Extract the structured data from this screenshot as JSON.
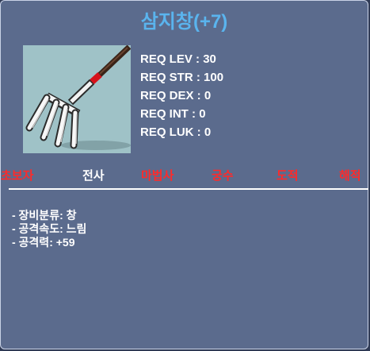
{
  "item": {
    "name": "삼지창(+7)",
    "name_color": "#5ab4ee",
    "icon": "trident-fork-icon"
  },
  "requirements": [
    {
      "label": "REQ LEV",
      "value": "30"
    },
    {
      "label": "REQ STR",
      "value": "100"
    },
    {
      "label": "REQ DEX",
      "value": "0"
    },
    {
      "label": "REQ INT",
      "value": "0"
    },
    {
      "label": "REQ LUK",
      "value": "0"
    }
  ],
  "jobs": [
    {
      "name": "초보자",
      "available": false
    },
    {
      "name": "전사",
      "available": true
    },
    {
      "name": "마법사",
      "available": false
    },
    {
      "name": "궁수",
      "available": false
    },
    {
      "name": "도적",
      "available": false
    },
    {
      "name": "해적",
      "available": false
    }
  ],
  "details": [
    "- 장비분류: 창",
    "- 공격속도: 느림",
    "- 공격력: +59"
  ],
  "colors": {
    "panel": "#5b6b8d",
    "available": "#ffffff",
    "unavailable": "#ff2a2a"
  }
}
